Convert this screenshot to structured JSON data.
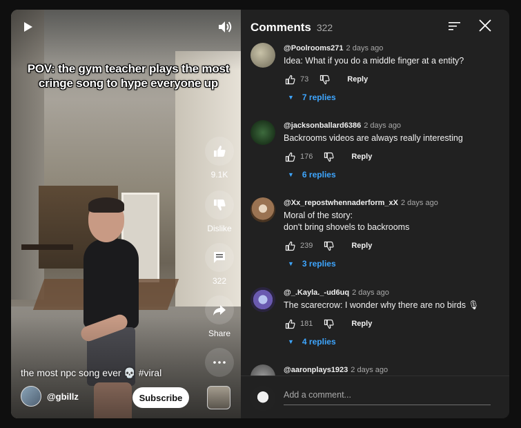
{
  "video": {
    "overlay_text": "POV: the gym teacher plays the most cringe song to hype everyone up",
    "caption": "the most npc song ever 💀 #viral",
    "channel": "@gbillz",
    "subscribe_label": "Subscribe",
    "actions": {
      "like_count": "9.1K",
      "dislike_label": "Dislike",
      "comment_count": "322",
      "share_label": "Share"
    },
    "icons": [
      "play-icon",
      "volume-icon",
      "thumbs-up-icon",
      "thumbs-down-icon",
      "comment-icon",
      "share-icon",
      "more-icon"
    ]
  },
  "comments_panel": {
    "title": "Comments",
    "count": "322",
    "add_placeholder": "Add a comment...",
    "reply_label": "Reply",
    "items": [
      {
        "author": "@Poolrooms271",
        "time": "2 days ago",
        "text": "Idea: What if you do a middle finger at a entity?",
        "likes": "73",
        "replies": "7 replies",
        "avatar_color": "#7d7a6a"
      },
      {
        "author": "@jacksonballard6386",
        "time": "2 days ago",
        "text": "Backrooms videos are always really interesting",
        "likes": "176",
        "replies": "6 replies",
        "avatar_color": "#1b3a1b"
      },
      {
        "author": "@Xx_repostwhennaderform_xX",
        "time": "2 days ago",
        "text": "Moral of the story:\ndon't bring shovels to backrooms",
        "likes": "239",
        "replies": "3 replies",
        "avatar_color": "#8a6a4a"
      },
      {
        "author": "@_.Kayla._-ud6uq",
        "time": "2 days ago",
        "text": "The scarecrow: I wonder why there are no birds 🎙",
        "likes": "181",
        "replies": "4 replies",
        "avatar_color": "#5a6aa8"
      },
      {
        "author": "@aaronplays1923",
        "time": "2 days ago",
        "text": "",
        "likes": "",
        "replies": "",
        "avatar_color": "#6a6a6a"
      }
    ]
  }
}
